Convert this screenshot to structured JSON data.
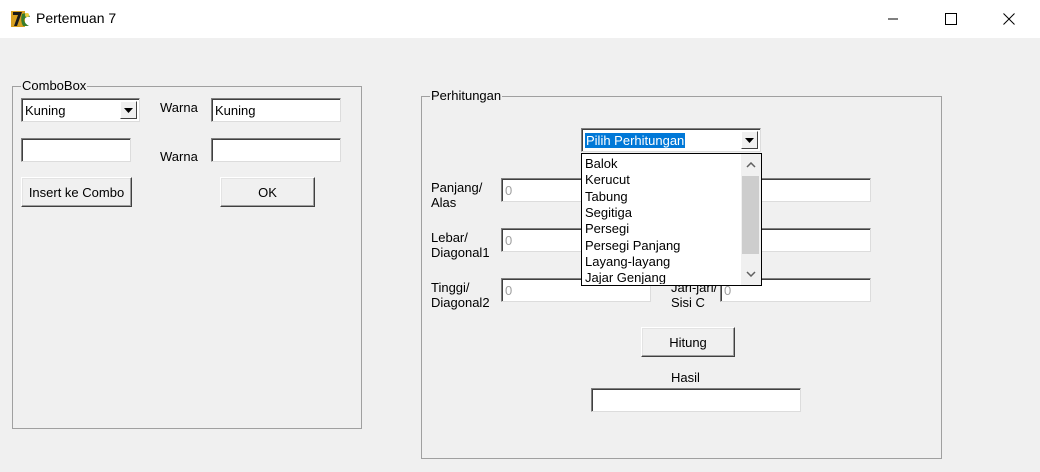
{
  "window": {
    "title": "Pertemuan 7",
    "icon": "delphi-app-icon",
    "controls": [
      "minimize-icon",
      "maximize-icon",
      "close-icon"
    ]
  },
  "combobox_group": {
    "title": "ComboBox",
    "combo_value": "Kuning",
    "new_item_value": "",
    "warna_label_1": "Warna",
    "warna_value_1": "Kuning",
    "warna_label_2": "Warna",
    "warna_value_2": "",
    "insert_button": "Insert ke Combo",
    "ok_button": "OK"
  },
  "perhitungan_group": {
    "title": "Perhitungan",
    "select_value": "Pilih Perhitungan",
    "options": [
      "Balok",
      "Kerucut",
      "Tabung",
      "Segitiga",
      "Persegi",
      "Persegi Panjang",
      "Layang-layang",
      "Jajar Genjang"
    ],
    "panjang_label_1": "Panjang/",
    "panjang_label_2": "Alas",
    "panjang_value": "0",
    "lebar_label_1": "Lebar/",
    "lebar_label_2": "Diagonal1",
    "lebar_value": "0",
    "tinggi_label_1": "Tinggi/",
    "tinggi_label_2": "Diagonal2",
    "tinggi_value": "0",
    "jari_label_1": "Jari-jari/",
    "jari_label_2": "Sisi C",
    "jari_value": "0",
    "right_value_1": "",
    "right_value_2": "",
    "hitung_button": "Hitung",
    "hasil_label": "Hasil",
    "hasil_value": ""
  },
  "colors": {
    "window_bg": "#f0f0f0",
    "titlebar_bg": "#ffffff",
    "selection": "#0078d7",
    "border": "#a0a0a0"
  }
}
